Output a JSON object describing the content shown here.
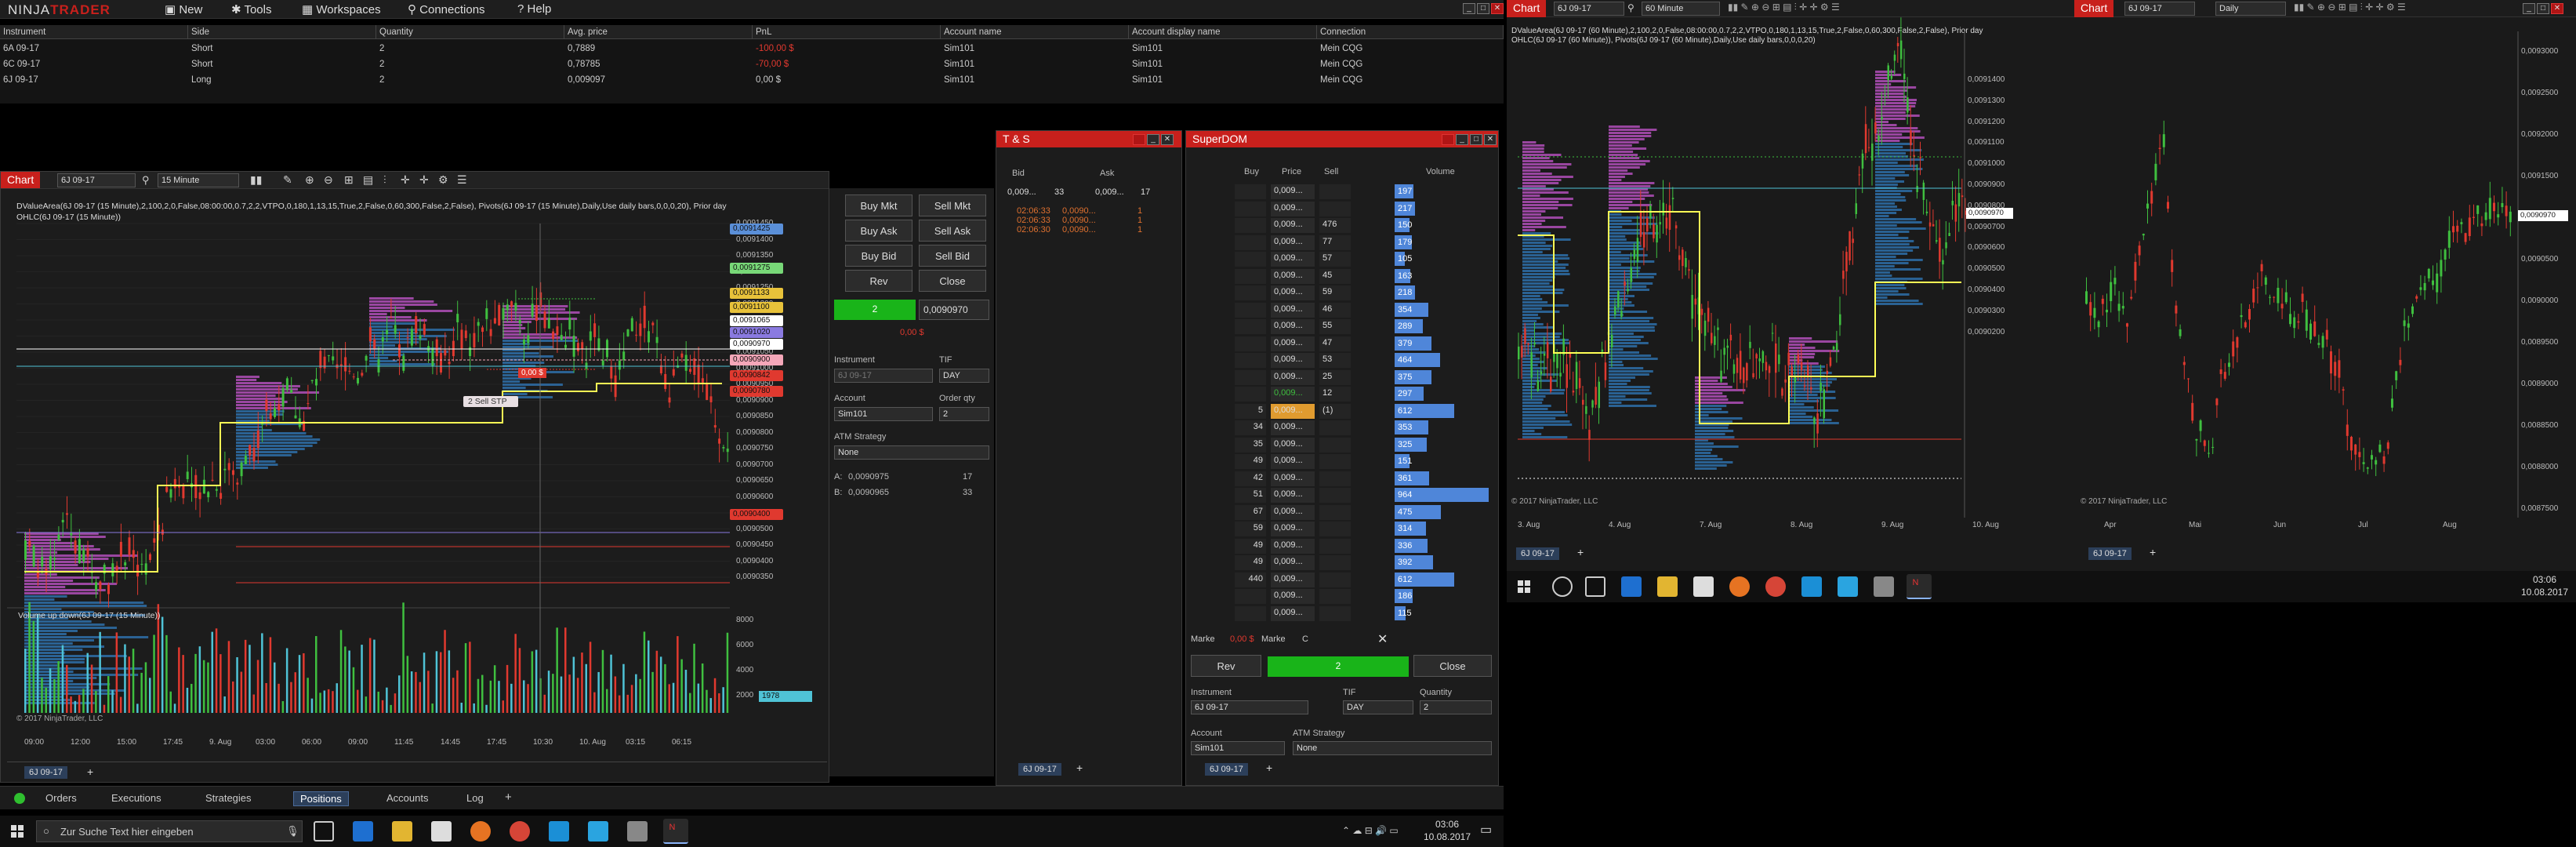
{
  "app": {
    "logo_prefix": "NINJA",
    "logo_suffix": "TRADER",
    "menu": [
      "New",
      "Tools",
      "Workspaces",
      "Connections",
      "Help"
    ]
  },
  "positions": {
    "columns": [
      "Instrument",
      "Side",
      "Quantity",
      "Avg. price",
      "PnL",
      "Account name",
      "Account display name",
      "Connection"
    ],
    "rows": [
      {
        "instrument": "6A 09-17",
        "side": "Short",
        "qty": "2",
        "avg": "0,7889",
        "pnl": "-100,00 $",
        "pnl_color": "#e0392f",
        "account": "Sim101",
        "display": "Sim101",
        "conn": "Mein CQG"
      },
      {
        "instrument": "6C 09-17",
        "side": "Short",
        "qty": "2",
        "avg": "0,78785",
        "pnl": "-70,00 $",
        "pnl_color": "#e0392f",
        "account": "Sim101",
        "display": "Sim101",
        "conn": "Mein CQG"
      },
      {
        "instrument": "6J 09-17",
        "side": "Long",
        "qty": "2",
        "avg": "0,009097",
        "pnl": "0,00 $",
        "pnl_color": "#cccccc",
        "account": "Sim101",
        "display": "Sim101",
        "conn": "Mein CQG"
      }
    ]
  },
  "chart1": {
    "tab": "Chart",
    "instrument": "6J 09-17",
    "interval": "15 Minute",
    "line1": "DValueArea(6J 09-17 (15 Minute),2,100,2,0,False,08:00:00,0.7,2,2,VTPO,0,180,1,13,15,True,2,False,0,60,300,False,2,False), Pivots(6J 09-17 (15 Minute),Daily,Use daily bars,0,0,0,20), Prior day",
    "line2": "OHLC(6J 09-17 (15 Minute))",
    "price_labels": [
      "0,0091450",
      "0,0091400",
      "0,0091350",
      "0,0091300",
      "0,0091250",
      "0,0091200",
      "0,0091150",
      "0,0091100",
      "0,0091050",
      "0,0091000",
      "0,0090950",
      "0,0090900",
      "0,0090850",
      "0,0090800",
      "0,0090750",
      "0,0090700",
      "0,0090650",
      "0,0090600",
      "0,0090550",
      "0,0090500",
      "0,0090450",
      "0,0090400",
      "0,0090350"
    ],
    "tags": [
      {
        "text": "0,0091425",
        "color": "#5a8fd8"
      },
      {
        "text": "0,0091275",
        "color": "#78d878"
      },
      {
        "text": "0,0091133",
        "color": "#e8c23a"
      },
      {
        "text": "0,0091100",
        "color": "#e8c23a"
      },
      {
        "text": "0,0091065",
        "color": "#ffffff"
      },
      {
        "text": "0,0091020",
        "color": "#8a7ae0"
      },
      {
        "text": "0,0090970",
        "color": "#ffffff"
      },
      {
        "text": "0,0090900",
        "color": "#f4a7b9"
      },
      {
        "text": "0,0090842",
        "color": "#e0392f"
      },
      {
        "text": "0,0090780",
        "color": "#e0392f"
      },
      {
        "text": "0,0090400",
        "color": "#e0392f"
      }
    ],
    "order_label": "2  Sell STP",
    "order_pnl": "0,00 $",
    "volume_title": "Volume up down(6J 09-17 (15 Minute))",
    "volume_axis": [
      "8000",
      "6000",
      "4000",
      "2000"
    ],
    "volume_last": "1978",
    "copyright": "© 2017 NinjaTrader, LLC",
    "time_labels": [
      "09:00",
      "12:00",
      "15:00",
      "17:45",
      "9. Aug",
      "03:00",
      "06:00",
      "09:00",
      "11:45",
      "14:45",
      "17:45",
      "10:30",
      "10. Aug",
      "03:15",
      "06:15"
    ],
    "bottom_tab": "6J 09-17"
  },
  "chart_data": [
    {
      "type": "line",
      "title": "",
      "x": [
        "09:00",
        "12:00",
        "15:00",
        "17:45",
        "9. Aug",
        "03:00",
        "06:00",
        "09:00",
        "11:45",
        "14:45",
        "17:45",
        "10. Aug",
        "03:15",
        "06:15"
      ],
      "series": [
        {
          "values": [
            0.00904,
            0.00906,
            0.00905,
            0.00907,
            0.0091,
            0.00911,
            0.00912,
            0.0091,
            0.00913,
            0.00914,
            0.00911,
            0.0091,
            0.009097,
            0.009097
          ]
        }
      ],
      "ylim": [
        0.009035,
        0.009145
      ]
    }
  ],
  "order_entry": {
    "buy_mkt": "Buy Mkt",
    "sell_mkt": "Sell Mkt",
    "buy_ask": "Buy Ask",
    "sell_ask": "Sell Ask",
    "buy_bid": "Buy Bid",
    "sell_bid": "Sell Bid",
    "rev": "Rev",
    "close": "Close",
    "pos_qty": "2",
    "pos_price": "0,0090970",
    "pos_pnl": "0,00 $",
    "instrument_label": "Instrument",
    "instrument_value": "6J 09-17",
    "tif_label": "TIF",
    "tif_value": "DAY",
    "account_label": "Account",
    "account_value": "Sim101",
    "qty_label": "Order qty",
    "qty_value": "2",
    "atm_label": "ATM Strategy",
    "atm_value": "None",
    "a_label": "A:",
    "a_value": "0,0090975",
    "a_size": "17",
    "b_label": "B:",
    "b_value": "0,0090965",
    "b_size": "33"
  },
  "ts": {
    "title": "T & S",
    "bid_label": "Bid",
    "ask_label": "Ask",
    "bid_val": "0,009...",
    "bid_size": "33",
    "ask_val": "0,009...",
    "ask_size": "17",
    "rows": [
      {
        "time": "02:06:33",
        "price": "0,0090...",
        "size": "1"
      },
      {
        "time": "02:06:33",
        "price": "0,0090...",
        "size": "1"
      },
      {
        "time": "02:06:30",
        "price": "0,0090...",
        "size": "1"
      }
    ],
    "tab": "6J 09-17"
  },
  "superdom": {
    "title": "SuperDOM",
    "cols": [
      "Buy",
      "Price",
      "Sell",
      "Volume"
    ],
    "rows": [
      {
        "buy": "",
        "price": "0,009...",
        "sell": "",
        "vol": "197",
        "w": 0.2
      },
      {
        "buy": "",
        "price": "0,009...",
        "sell": "",
        "vol": "217",
        "w": 0.22
      },
      {
        "buy": "",
        "price": "0,009...",
        "sell": "476",
        "vol": "150",
        "w": 0.16
      },
      {
        "buy": "",
        "price": "0,009...",
        "sell": "77",
        "vol": "179",
        "w": 0.18
      },
      {
        "buy": "",
        "price": "0,009...",
        "sell": "57",
        "vol": "105",
        "w": 0.11
      },
      {
        "buy": "",
        "price": "0,009...",
        "sell": "45",
        "vol": "163",
        "w": 0.17
      },
      {
        "buy": "",
        "price": "0,009...",
        "sell": "59",
        "vol": "218",
        "w": 0.22
      },
      {
        "buy": "",
        "price": "0,009...",
        "sell": "46",
        "vol": "354",
        "w": 0.36
      },
      {
        "buy": "",
        "price": "0,009...",
        "sell": "55",
        "vol": "289",
        "w": 0.3
      },
      {
        "buy": "",
        "price": "0,009...",
        "sell": "47",
        "vol": "379",
        "w": 0.39
      },
      {
        "buy": "",
        "price": "0,009...",
        "sell": "53",
        "vol": "464",
        "w": 0.48
      },
      {
        "buy": "",
        "price": "0,009...",
        "sell": "25",
        "vol": "375",
        "w": 0.39
      },
      {
        "buy": "",
        "price": "0,009...",
        "sell": "12",
        "vol": "297",
        "w": 0.31
      },
      {
        "buy": "5",
        "price": "0,009...",
        "sell": "(1)",
        "vol": "612",
        "w": 0.63
      },
      {
        "buy": "34",
        "price": "0,009...",
        "sell": "",
        "vol": "353",
        "w": 0.36
      },
      {
        "buy": "35",
        "price": "0,009...",
        "sell": "",
        "vol": "325",
        "w": 0.34
      },
      {
        "buy": "49",
        "price": "0,009...",
        "sell": "",
        "vol": "151",
        "w": 0.16
      },
      {
        "buy": "42",
        "price": "0,009...",
        "sell": "",
        "vol": "361",
        "w": 0.37
      },
      {
        "buy": "51",
        "price": "0,009...",
        "sell": "",
        "vol": "964",
        "w": 1.0
      },
      {
        "buy": "67",
        "price": "0,009...",
        "sell": "",
        "vol": "475",
        "w": 0.49
      },
      {
        "buy": "59",
        "price": "0,009...",
        "sell": "",
        "vol": "314",
        "w": 0.33
      },
      {
        "buy": "49",
        "price": "0,009...",
        "sell": "",
        "vol": "336",
        "w": 0.35
      },
      {
        "buy": "49",
        "price": "0,009...",
        "sell": "",
        "vol": "392",
        "w": 0.41
      },
      {
        "buy": "440",
        "price": "0,009...",
        "sell": "",
        "vol": "612",
        "w": 0.63
      },
      {
        "buy": "",
        "price": "0,009...",
        "sell": "",
        "vol": "186",
        "w": 0.19
      },
      {
        "buy": "",
        "price": "0,009...",
        "sell": "",
        "vol": "115",
        "w": 0.12
      }
    ],
    "market_left": "Marke",
    "market_pnl": "0,00 $",
    "market_right": "Marke",
    "market_c": "C",
    "rev": "Rev",
    "pos_qty": "2",
    "close": "Close",
    "instrument_label": "Instrument",
    "instrument_value": "6J 09-17",
    "tif_label": "TIF",
    "tif_value": "DAY",
    "qty_label": "Quantity",
    "qty_value": "2",
    "account_label": "Account",
    "account_value": "Sim101",
    "atm_label": "ATM Strategy",
    "atm_value": "None",
    "tab": "6J 09-17"
  },
  "chart2": {
    "tab": "Chart",
    "instrument": "6J 09-17",
    "interval": "60 Minute",
    "line1": "DValueArea(6J 09-17 (60 Minute),2,100,2,0,False,08:00:00,0.7,2,2,VTPO,0,180,1,13,15,True,2,False,0,60,300,False,2,False), Prior day",
    "line2": "OHLC(6J 09-17 (60 Minute)), Pivots(6J 09-17 (60 Minute),Daily,Use daily bars,0,0,0,20)",
    "price_labels": [
      "0,0091400",
      "0,0091300",
      "0,0091200",
      "0,0091100",
      "0,0091000",
      "0,0090900",
      "0,0090800",
      "0,0090700",
      "0,0090600",
      "0,0090500",
      "0,0090400",
      "0,0090300",
      "0,0090200"
    ],
    "last": "0,0090970",
    "time_labels": [
      "3. Aug",
      "4. Aug",
      "7. Aug",
      "8. Aug",
      "9. Aug",
      "10. Aug"
    ],
    "copyright": "© 2017 NinjaTrader, LLC",
    "bottom_tab": "6J 09-17"
  },
  "chart3": {
    "tab": "Chart",
    "instrument": "6J 09-17",
    "interval": "Daily",
    "price_labels": [
      "0,0093000",
      "0,0092500",
      "0,0092000",
      "0,0091500",
      "0,0091000",
      "0,0090500",
      "0,0090000",
      "0,0089500",
      "0,0089000",
      "0,0088500",
      "0,0088000",
      "0,0087500"
    ],
    "last": "0,0090970",
    "time_labels": [
      "Apr",
      "Mai",
      "Jun",
      "Jul",
      "Aug"
    ],
    "copyright": "© 2017 NinjaTrader, LLC",
    "bottom_tab": "6J 09-17"
  },
  "bottom_tabs": [
    "Orders",
    "Executions",
    "Strategies",
    "Positions",
    "Accounts",
    "Log"
  ],
  "bottom_tabs_active": "Positions",
  "taskbar1": {
    "search_placeholder": "Zur Suche Text hier eingeben",
    "time": "03:06",
    "date": "10.08.2017"
  },
  "taskbar2": {
    "time": "03:06",
    "date": "10.08.2017"
  }
}
